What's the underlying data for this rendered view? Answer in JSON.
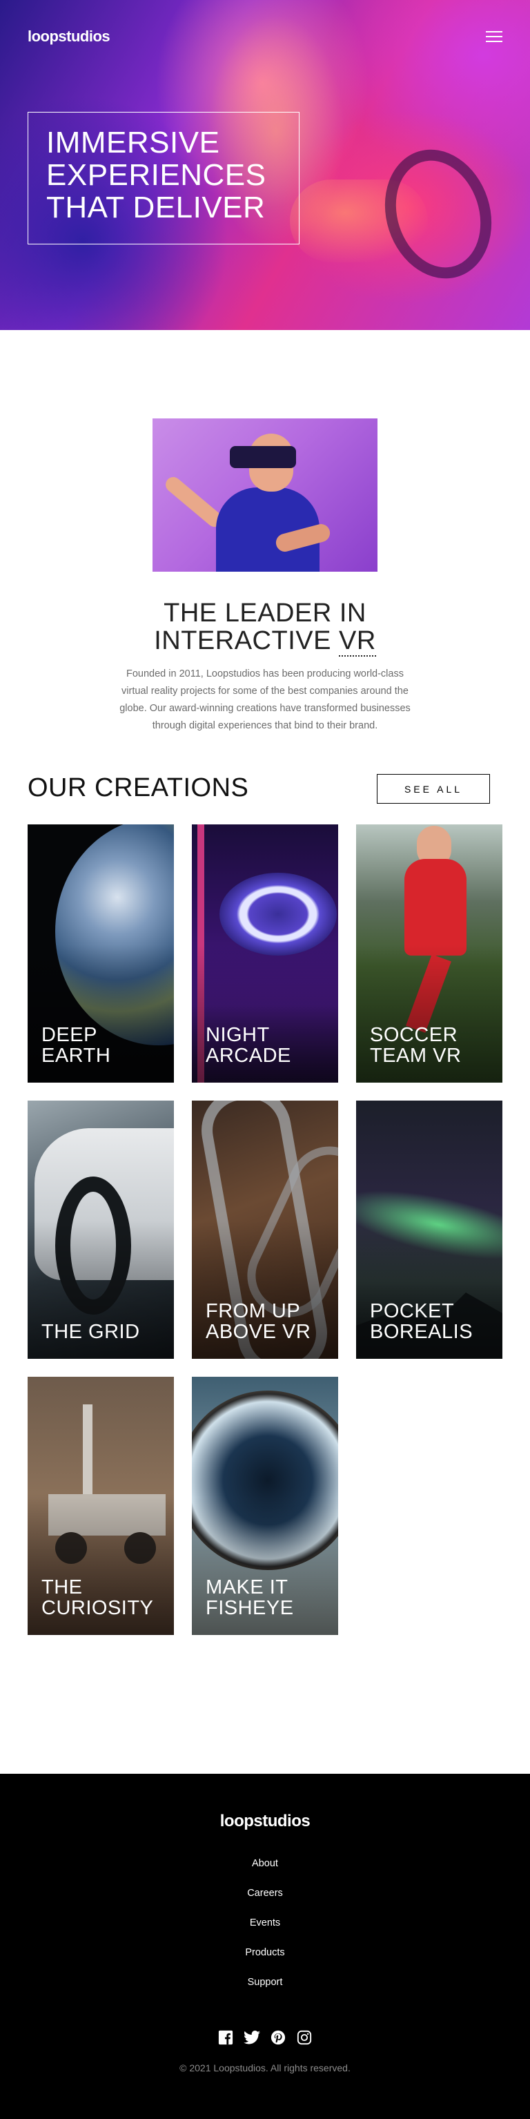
{
  "header": {
    "logo": "loopstudios",
    "menu_icon": "hamburger-menu-icon",
    "hero_title": "Immersive experiences that deliver"
  },
  "about": {
    "image_icon": "vr-headset-man-photo",
    "title_line1": "The leader in",
    "title_line2_prefix": "interactive ",
    "title_line2_abbr": "VR",
    "text": "Founded in 2011, Loopstudios has been producing world-class virtual reality projects for some of the best companies around the globe. Our award-winning creations have transformed businesses through digital experiences that bind to their brand."
  },
  "creations": {
    "title": "Our creations",
    "see_all": "See all",
    "items": [
      {
        "line1": "Deep",
        "line2": "earth"
      },
      {
        "line1": "Night",
        "line2": "arcade"
      },
      {
        "line1": "Soccer",
        "line2": "team VR"
      },
      {
        "line1": "",
        "line2": "The grid"
      },
      {
        "line1": "From up",
        "line2": "above VR"
      },
      {
        "line1": "Pocket",
        "line2": "borealis"
      },
      {
        "line1": "The",
        "line2": "curiosity"
      },
      {
        "line1": "Make it",
        "line2": "fisheye"
      }
    ]
  },
  "footer": {
    "logo": "loopstudios",
    "links": [
      "About",
      "Careers",
      "Events",
      "Products",
      "Support"
    ],
    "social_icons": [
      "facebook-icon",
      "twitter-icon",
      "pinterest-icon",
      "instagram-icon"
    ],
    "copyright": "© 2021 Loopstudios. All rights reserved."
  },
  "colors": {
    "footer_bg": "#000000",
    "body_text": "#6b6b6b",
    "hero_accent": "#d73c9b"
  }
}
